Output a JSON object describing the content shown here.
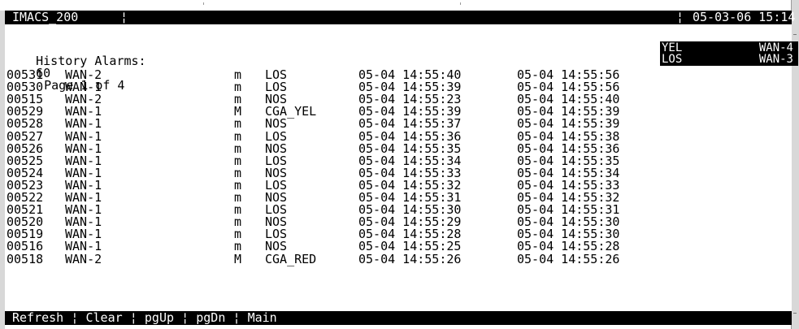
{
  "title_bar": {
    "system": "IMACS_200",
    "datetime": "05-03-06 15:14",
    "sep": "¦"
  },
  "heading": {
    "label": "History Alarms:",
    "count": "60",
    "page": "Page 1 of 4"
  },
  "active_alarms": [
    {
      "type": "YEL",
      "port": "WAN-4"
    },
    {
      "type": "LOS",
      "port": "WAN-3"
    }
  ],
  "alarms": [
    {
      "id": "00531",
      "port": "WAN-2",
      "sev": "m",
      "type": "LOS",
      "start": "05-04 14:55:40",
      "end": "05-04 14:55:56"
    },
    {
      "id": "00530",
      "port": "WAN-1",
      "sev": "m",
      "type": "LOS",
      "start": "05-04 14:55:39",
      "end": "05-04 14:55:56"
    },
    {
      "id": "00515",
      "port": "WAN-2",
      "sev": "m",
      "type": "NOS",
      "start": "05-04 14:55:23",
      "end": "05-04 14:55:40"
    },
    {
      "id": "00529",
      "port": "WAN-1",
      "sev": "M",
      "type": "CGA_YEL",
      "start": "05-04 14:55:39",
      "end": "05-04 14:55:39"
    },
    {
      "id": "00528",
      "port": "WAN-1",
      "sev": "m",
      "type": "NOS",
      "start": "05-04 14:55:37",
      "end": "05-04 14:55:39"
    },
    {
      "id": "00527",
      "port": "WAN-1",
      "sev": "m",
      "type": "LOS",
      "start": "05-04 14:55:36",
      "end": "05-04 14:55:38"
    },
    {
      "id": "00526",
      "port": "WAN-1",
      "sev": "m",
      "type": "NOS",
      "start": "05-04 14:55:35",
      "end": "05-04 14:55:36"
    },
    {
      "id": "00525",
      "port": "WAN-1",
      "sev": "m",
      "type": "LOS",
      "start": "05-04 14:55:34",
      "end": "05-04 14:55:35"
    },
    {
      "id": "00524",
      "port": "WAN-1",
      "sev": "m",
      "type": "NOS",
      "start": "05-04 14:55:33",
      "end": "05-04 14:55:34"
    },
    {
      "id": "00523",
      "port": "WAN-1",
      "sev": "m",
      "type": "LOS",
      "start": "05-04 14:55:32",
      "end": "05-04 14:55:33"
    },
    {
      "id": "00522",
      "port": "WAN-1",
      "sev": "m",
      "type": "NOS",
      "start": "05-04 14:55:31",
      "end": "05-04 14:55:32"
    },
    {
      "id": "00521",
      "port": "WAN-1",
      "sev": "m",
      "type": "LOS",
      "start": "05-04 14:55:30",
      "end": "05-04 14:55:31"
    },
    {
      "id": "00520",
      "port": "WAN-1",
      "sev": "m",
      "type": "NOS",
      "start": "05-04 14:55:29",
      "end": "05-04 14:55:30"
    },
    {
      "id": "00519",
      "port": "WAN-1",
      "sev": "m",
      "type": "LOS",
      "start": "05-04 14:55:28",
      "end": "05-04 14:55:30"
    },
    {
      "id": "00516",
      "port": "WAN-1",
      "sev": "m",
      "type": "NOS",
      "start": "05-04 14:55:25",
      "end": "05-04 14:55:28"
    },
    {
      "id": "00518",
      "port": "WAN-2",
      "sev": "M",
      "type": "CGA_RED",
      "start": "05-04 14:55:26",
      "end": "05-04 14:55:26"
    }
  ],
  "menu": {
    "items": [
      "Refresh",
      "Clear",
      "pgUp",
      "pgDn",
      "Main"
    ],
    "sep": "¦"
  }
}
